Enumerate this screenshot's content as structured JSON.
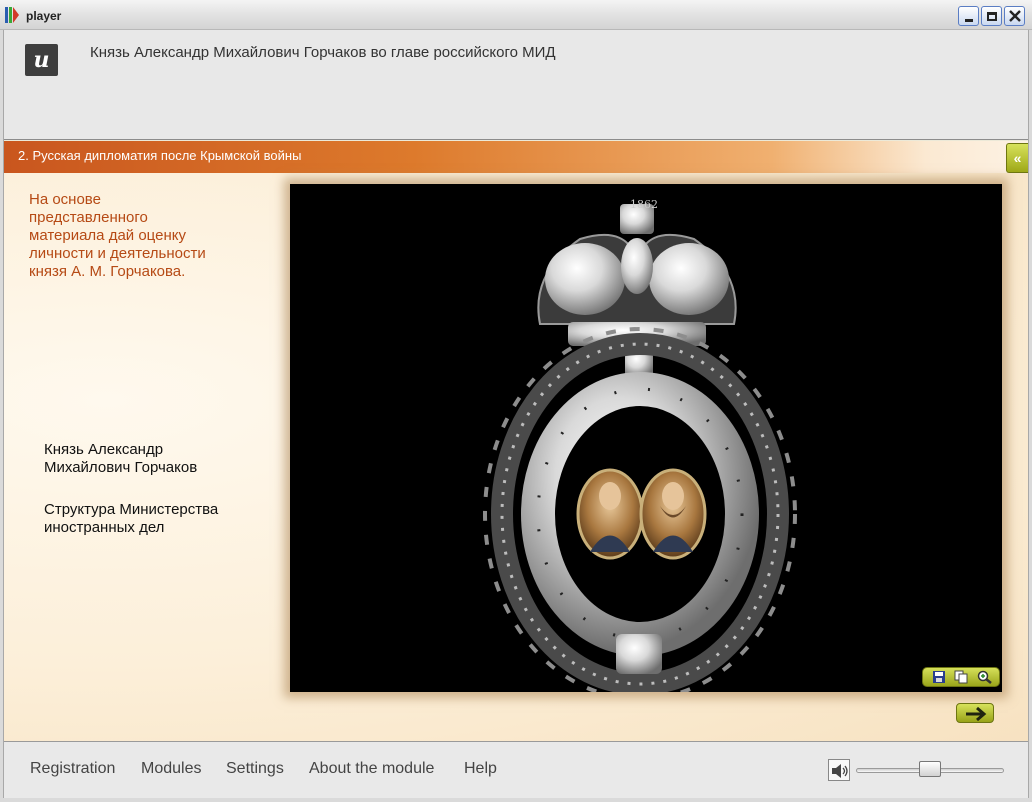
{
  "window": {
    "title": "player"
  },
  "header": {
    "logo_glyph": "и",
    "title": "Князь Александр Михайлович Горчаков во главе российского МИД"
  },
  "section": {
    "title": "2. Русская дипломатия после Крымской войны",
    "collapse_glyph": "«"
  },
  "content": {
    "task_text": "На основе\nпредставленного\nматериала дай оценку\nличности и деятельности\nкнязя А. М. Горчакова.",
    "links": [
      "Князь Александр\nМихайлович Горчаков",
      "Структура Министерства\nиностранных дел"
    ],
    "image": {
      "description": "diamond badge with crown and two portraits",
      "crown_year": "1862"
    },
    "image_tools": [
      "save-icon",
      "copy-icon",
      "zoom-icon"
    ]
  },
  "footer": {
    "menu": [
      "Registration",
      "Modules",
      "Settings",
      "About the module",
      "Help"
    ],
    "volume_level": 0.5
  },
  "colors": {
    "accent_orange": "#c9561e",
    "task_text": "#b64a15",
    "green_button": "#b8c33a"
  }
}
